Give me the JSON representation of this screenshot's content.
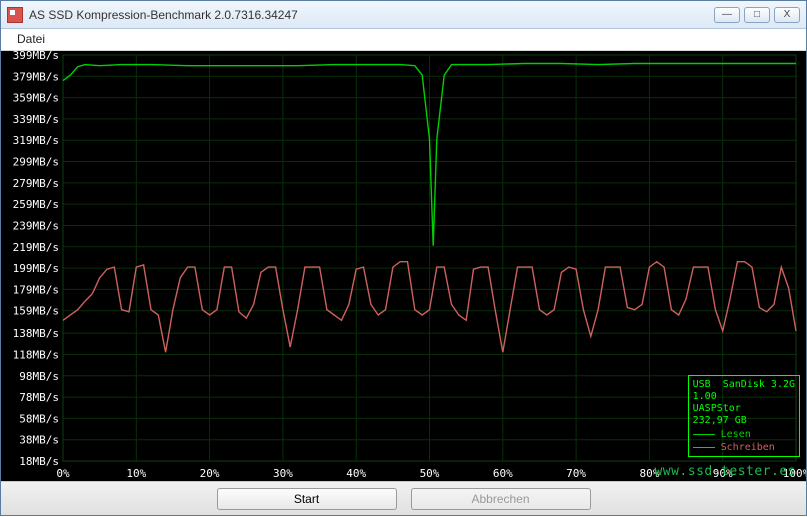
{
  "window": {
    "title": "AS SSD Kompression-Benchmark 2.0.7316.34247",
    "btn_min": "—",
    "btn_max": "□",
    "btn_close": "X"
  },
  "menu": {
    "datei": "Datei"
  },
  "buttons": {
    "start": "Start",
    "abort": "Abbrechen"
  },
  "legend": {
    "device_line1": "USB  SanDisk 3.2G",
    "device_line2": "1.00",
    "device_line3": "UASPStor",
    "device_line4": "232,97 GB",
    "read": "Lesen",
    "write": "Schreiben",
    "read_color": "#00d000",
    "write_color": "#d06060"
  },
  "watermark": "www.ssd-tester.es",
  "chart_data": {
    "type": "line",
    "xlabel": "",
    "ylabel": "",
    "x_unit": "%",
    "y_unit": "MB/s",
    "xlim": [
      0,
      100
    ],
    "ylim": [
      18,
      399
    ],
    "x_ticks": [
      0,
      10,
      20,
      30,
      40,
      50,
      60,
      70,
      80,
      90,
      100
    ],
    "y_ticks": [
      399,
      379,
      359,
      339,
      319,
      299,
      279,
      259,
      239,
      219,
      199,
      179,
      159,
      138,
      118,
      98,
      78,
      58,
      38,
      18
    ],
    "series": [
      {
        "name": "Lesen",
        "color": "#00d000",
        "x": [
          0,
          1,
          2,
          3,
          5,
          8,
          12,
          17,
          22,
          27,
          32,
          37,
          42,
          46,
          48,
          49,
          50,
          50.5,
          51,
          52,
          53,
          55,
          58,
          63,
          68,
          73,
          78,
          83,
          88,
          92,
          96,
          100
        ],
        "y": [
          375,
          380,
          388,
          390,
          389,
          390,
          390,
          389,
          389,
          389,
          389,
          390,
          390,
          390,
          389,
          380,
          320,
          220,
          320,
          380,
          390,
          390,
          390,
          391,
          391,
          390,
          391,
          391,
          391,
          391,
          391,
          391
        ]
      },
      {
        "name": "Schreiben",
        "color": "#d06060",
        "x": [
          0,
          2,
          3,
          4,
          5,
          6,
          7,
          8,
          9,
          10,
          11,
          12,
          13,
          14,
          15,
          16,
          17,
          18,
          19,
          20,
          21,
          22,
          23,
          24,
          25,
          26,
          27,
          28,
          29,
          30,
          31,
          32,
          33,
          34,
          35,
          36,
          37,
          38,
          39,
          40,
          41,
          42,
          43,
          44,
          45,
          46,
          47,
          48,
          49,
          50,
          51,
          52,
          53,
          54,
          55,
          56,
          57,
          58,
          59,
          60,
          61,
          62,
          63,
          64,
          65,
          66,
          67,
          68,
          69,
          70,
          71,
          72,
          73,
          74,
          75,
          76,
          77,
          78,
          79,
          80,
          81,
          82,
          83,
          84,
          85,
          86,
          87,
          88,
          89,
          90,
          91,
          92,
          93,
          94,
          95,
          96,
          97,
          98,
          99,
          100
        ],
        "y": [
          150,
          160,
          168,
          175,
          190,
          198,
          200,
          160,
          158,
          200,
          202,
          160,
          155,
          120,
          160,
          190,
          200,
          200,
          160,
          155,
          160,
          200,
          200,
          158,
          152,
          165,
          195,
          200,
          200,
          160,
          125,
          160,
          200,
          200,
          200,
          160,
          155,
          150,
          165,
          198,
          200,
          165,
          155,
          160,
          200,
          205,
          205,
          160,
          155,
          160,
          200,
          200,
          165,
          155,
          150,
          198,
          200,
          200,
          158,
          120,
          160,
          200,
          200,
          200,
          160,
          155,
          160,
          195,
          200,
          198,
          160,
          135,
          160,
          200,
          200,
          200,
          162,
          160,
          165,
          200,
          205,
          200,
          160,
          155,
          170,
          200,
          200,
          200,
          160,
          140,
          170,
          205,
          205,
          200,
          162,
          158,
          165,
          200,
          180,
          140
        ]
      }
    ]
  }
}
